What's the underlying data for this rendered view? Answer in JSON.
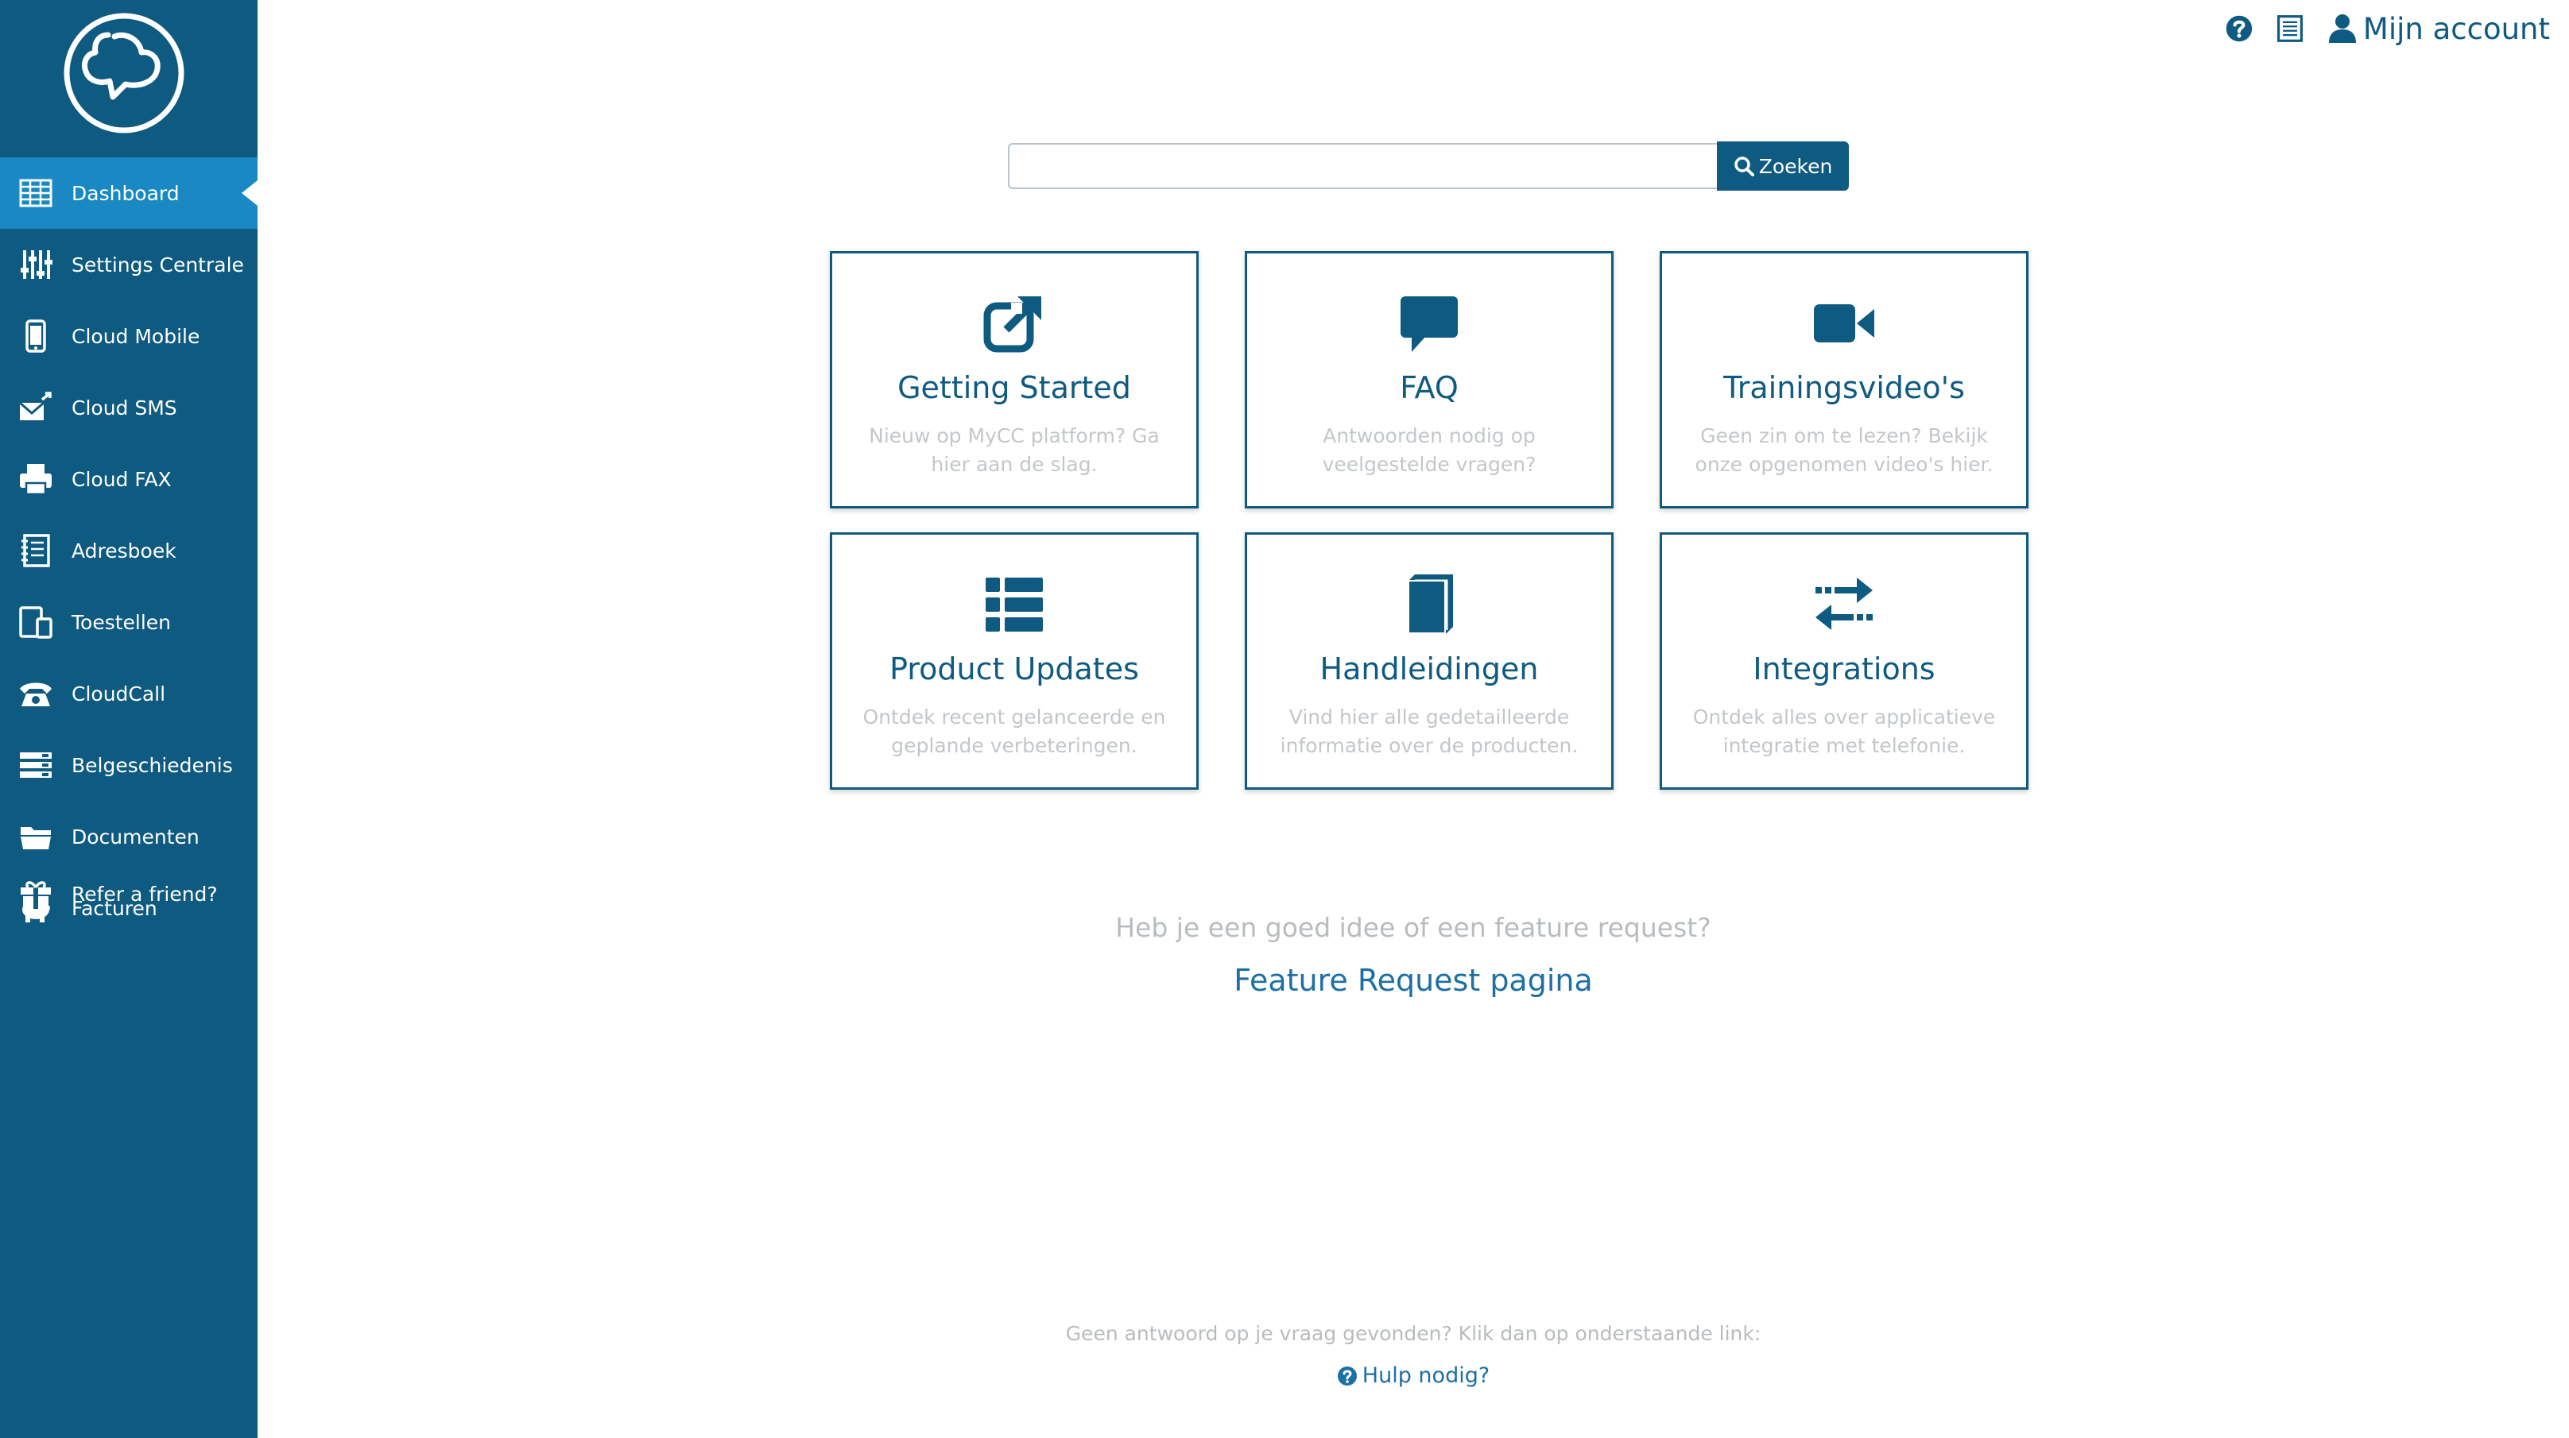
{
  "colors": {
    "sidebar": "#0f5a80",
    "sidebar_active": "#1a88c3",
    "accent": "#0f5a80",
    "muted_text": "#c3c7ca",
    "link": "#1d6fa5"
  },
  "sidebar": {
    "logo_icon": "cloud-chat-logo",
    "items": [
      {
        "label": "Dashboard",
        "icon": "table-grid-icon",
        "active": true
      },
      {
        "label": "Settings Centrale",
        "icon": "sliders-icon"
      },
      {
        "label": "Cloud Mobile",
        "icon": "mobile-phone-icon"
      },
      {
        "label": "Cloud SMS",
        "icon": "envelope-send-icon"
      },
      {
        "label": "Cloud FAX",
        "icon": "printer-icon"
      },
      {
        "label": "Adresboek",
        "icon": "address-book-icon"
      },
      {
        "label": "Toestellen",
        "icon": "devices-icon"
      },
      {
        "label": "CloudCall",
        "icon": "phone-icon"
      },
      {
        "label": "Belgeschiedenis",
        "icon": "call-history-icon"
      },
      {
        "label": "Documenten",
        "icon": "folder-open-icon"
      },
      {
        "label": "Facturen",
        "icon": "piggy-bank-icon"
      }
    ],
    "refer": {
      "label": "Refer a friend?",
      "icon": "gift-icon"
    }
  },
  "topbar": {
    "help_icon": "question-circle-icon",
    "list_icon": "list-document-icon",
    "account_label": "Mijn account",
    "account_icon": "user-icon"
  },
  "search": {
    "value": "",
    "placeholder": "",
    "button_label": "Zoeken",
    "button_icon": "search-icon"
  },
  "cards": [
    {
      "title": "Getting Started",
      "desc": "Nieuw op MyCC platform? Ga hier aan de slag.",
      "icon": "external-link-icon"
    },
    {
      "title": "FAQ",
      "desc": "Antwoorden nodig op veelgestelde vragen?",
      "icon": "speech-bubble-icon"
    },
    {
      "title": "Trainingsvideo's",
      "desc": "Geen zin om te lezen? Bekijk onze opgenomen video's hier.",
      "icon": "video-camera-icon"
    },
    {
      "title": "Product Updates",
      "desc": "Ontdek recent gelanceerde en geplande verbeteringen.",
      "icon": "list-icon"
    },
    {
      "title": "Handleidingen",
      "desc": "Vind hier alle gedetailleerde informatie over de producten.",
      "icon": "book-icon"
    },
    {
      "title": "Integrations",
      "desc": "Ontdek alles over applicatieve integratie met telefonie.",
      "icon": "exchange-arrows-icon"
    }
  ],
  "feature": {
    "question": "Heb je een goed idee of een feature request?",
    "link": "Feature Request pagina"
  },
  "help": {
    "question": "Geen antwoord op je vraag gevonden? Klik dan op onderstaande link:",
    "link": "Hulp nodig?",
    "icon": "question-circle-icon"
  }
}
